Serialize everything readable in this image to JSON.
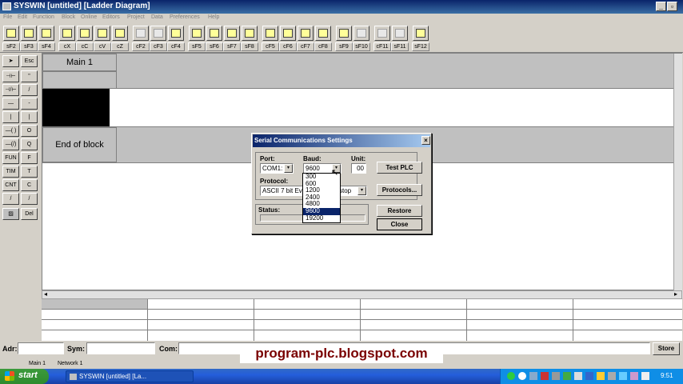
{
  "window": {
    "title": "SYSWIN [untitled] [Ladder Diagram]"
  },
  "menu": [
    "File",
    "Edit",
    "Function",
    "Block",
    "Online",
    "Editors",
    "Project",
    "Data",
    "Preferences",
    "Help"
  ],
  "toolbar": {
    "labels": [
      "sF2",
      "sF3",
      "sF4",
      "cX",
      "cC",
      "cV",
      "cZ",
      "cF2",
      "cF3",
      "cF4",
      "sF5",
      "sF6",
      "sF7",
      "sF8",
      "cF5",
      "cF6",
      "cF7",
      "cF8",
      "sF9",
      "sF10",
      "cF11",
      "sF11",
      "sF12"
    ]
  },
  "palette": {
    "left": [
      "",
      "⊣⊢",
      "⊣/⊢",
      "—",
      "|",
      "—( )",
      "—(/)",
      "FUN",
      "TIM",
      "CNT",
      "/",
      ""
    ],
    "right": [
      "Esc",
      "\"",
      "/",
      "-",
      "|",
      "O",
      "Q",
      "F",
      "T",
      "C",
      "/",
      "Del"
    ]
  },
  "ladder": {
    "block_title": "Main 1",
    "end_label": "End of block"
  },
  "dialog": {
    "title": "Serial Communications Settings",
    "port_label": "Port:",
    "port_value": "COM1:",
    "baud_label": "Baud:",
    "baud_value": "9600",
    "unit_label": "Unit:",
    "unit_value": "00",
    "protocol_label": "Protocol:",
    "protocol_value": "ASCII 7 bit Ev",
    "protocol_tail": "stop",
    "status_label": "Status:",
    "buttons": {
      "test": "Test PLC",
      "protocols": "Protocols...",
      "restore": "Restore",
      "close": "Close"
    },
    "baud_options": [
      "300",
      "600",
      "1200",
      "2400",
      "4800",
      "9600",
      "19200"
    ],
    "baud_selected_index": 5
  },
  "bottom": {
    "adr_label": "Adr:",
    "sym_label": "Sym:",
    "com_label": "Com:",
    "store_label": "Store"
  },
  "status_bar": {
    "left": "Main 1",
    "right": "Network 1"
  },
  "taskbar": {
    "start": "start",
    "task": "SYSWIN [untitled] [La...",
    "clock": "9:51"
  },
  "watermark": "program-plc.blogspot.com"
}
